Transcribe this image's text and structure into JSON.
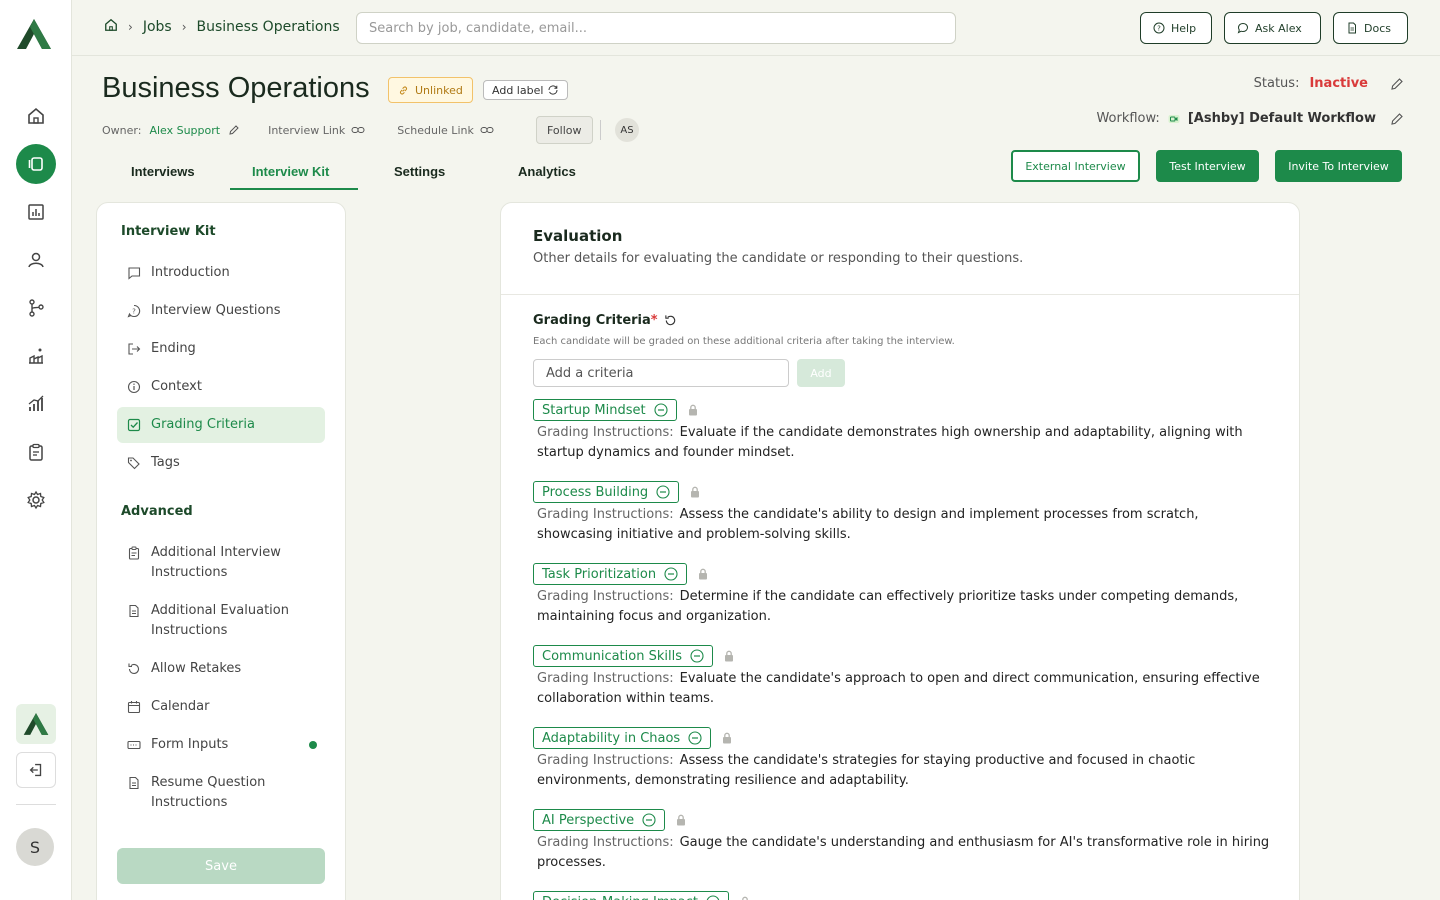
{
  "rail": {
    "nav_icons": [
      "home-icon",
      "interviews-icon",
      "reports-icon",
      "candidates-icon",
      "workflow-icon",
      "integrations-icon",
      "analytics-icon",
      "clipboard-icon",
      "settings-icon"
    ],
    "avatar_initial": "S"
  },
  "breadcrumb": {
    "items": [
      "Jobs",
      "Business Operations"
    ]
  },
  "search": {
    "placeholder": "Search by job, candidate, email..."
  },
  "top_buttons": {
    "help": "Help",
    "ask_alex": "Ask Alex",
    "docs": "Docs"
  },
  "job": {
    "title": "Business Operations",
    "linked_badge": "Unlinked",
    "add_label": "Add label",
    "owner_label": "Owner:",
    "owner_name": "Alex Support",
    "interview_link": "Interview Link",
    "schedule_link": "Schedule Link",
    "follow": "Follow",
    "follower_initials": "AS",
    "status_label": "Status:",
    "status_value": "Inactive",
    "workflow_label": "Workflow:",
    "workflow_name": "[Ashby] Default Workflow"
  },
  "tabs": [
    "Interviews",
    "Interview Kit",
    "Settings",
    "Analytics"
  ],
  "actions": {
    "external_interview": "External Interview",
    "test_interview": "Test Interview",
    "invite_to_interview": "Invite To Interview"
  },
  "sidebar": {
    "heading": "Interview Kit",
    "items": [
      "Introduction",
      "Interview Questions",
      "Ending",
      "Context",
      "Grading Criteria",
      "Tags"
    ],
    "advanced_heading": "Advanced",
    "advanced_items": [
      "Additional Interview Instructions",
      "Additional Evaluation Instructions",
      "Allow Retakes",
      "Calendar",
      "Form Inputs",
      "Resume Question Instructions"
    ],
    "save": "Save"
  },
  "evaluation": {
    "title": "Evaluation",
    "subtitle": "Other details for evaluating the candidate or responding to their questions.",
    "grading_label": "Grading Criteria",
    "required_mark": "*",
    "grading_help": "Each candidate will be graded on these additional criteria after taking the interview.",
    "criteria_placeholder": "Add a criteria",
    "add_button": "Add",
    "instructions_label": "Grading Instructions:",
    "criteria": [
      {
        "name": "Startup Mindset",
        "instructions": "Evaluate if the candidate demonstrates high ownership and adaptability, aligning with startup dynamics and founder mindset."
      },
      {
        "name": "Process Building",
        "instructions": "Assess the candidate's ability to design and implement processes from scratch, showcasing initiative and problem-solving skills."
      },
      {
        "name": "Task Prioritization",
        "instructions": "Determine if the candidate can effectively prioritize tasks under competing demands, maintaining focus and organization."
      },
      {
        "name": "Communication Skills",
        "instructions": "Evaluate the candidate's approach to open and direct communication, ensuring effective collaboration within teams."
      },
      {
        "name": "Adaptability in Chaos",
        "instructions": "Assess the candidate's strategies for staying productive and focused in chaotic environments, demonstrating resilience and adaptability."
      },
      {
        "name": "AI Perspective",
        "instructions": "Gauge the candidate's understanding and enthusiasm for AI's transformative role in hiring processes."
      },
      {
        "name": "Decision-Making Impact",
        "instructions": ""
      }
    ]
  },
  "colors": {
    "brand_green": "#1d8a4a",
    "inactive_red": "#d93a3a",
    "background": "#f4f5ee"
  }
}
